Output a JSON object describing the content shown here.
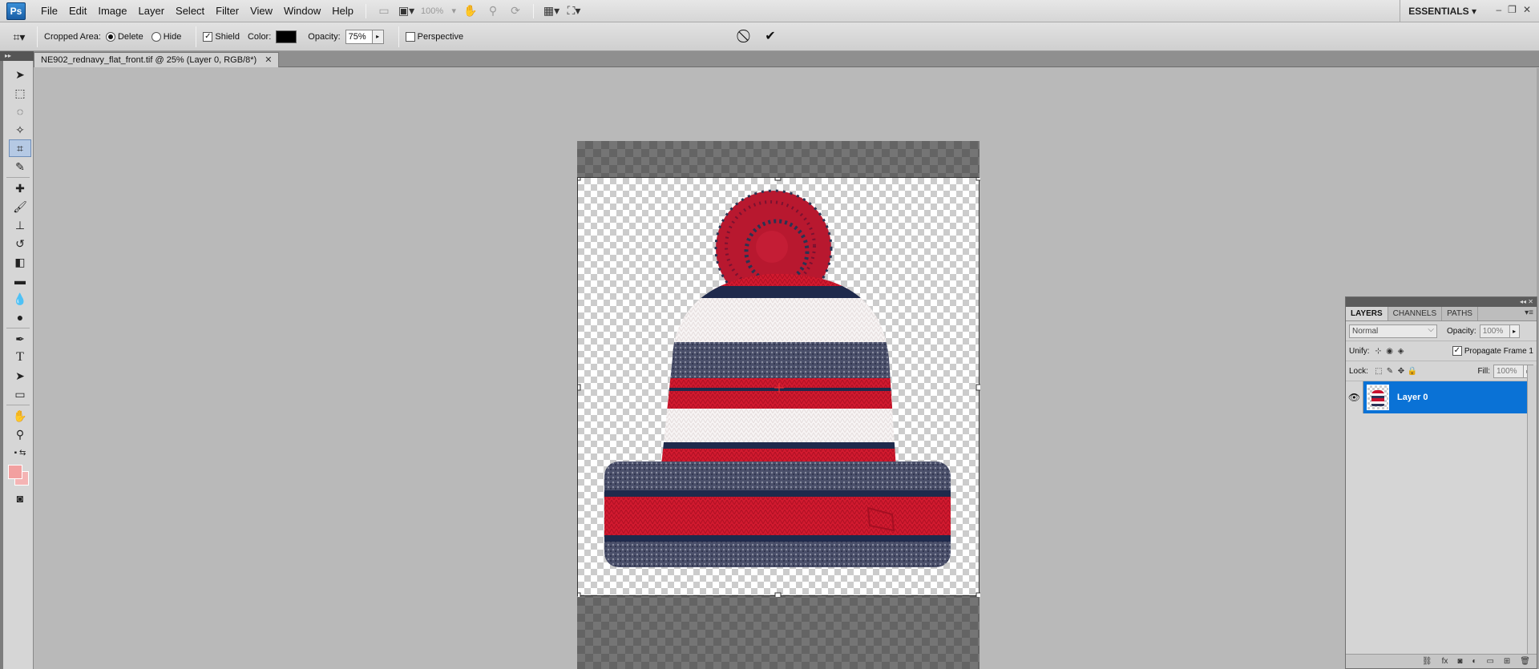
{
  "menubar": {
    "logo": "Ps",
    "items": [
      "File",
      "Edit",
      "Image",
      "Layer",
      "Select",
      "Filter",
      "View",
      "Window",
      "Help"
    ],
    "zoom": "100%",
    "workspace": "ESSENTIALS"
  },
  "options": {
    "cropped_area_label": "Cropped Area:",
    "delete_label": "Delete",
    "hide_label": "Hide",
    "shield_label": "Shield",
    "color_label": "Color:",
    "shield_color": "#000000",
    "opacity_label": "Opacity:",
    "opacity_value": "75%",
    "perspective_label": "Perspective"
  },
  "document": {
    "tab_title": "NE902_rednavy_flat_front.tif @ 25% (Layer 0, RGB/8*)"
  },
  "layers_panel": {
    "tabs": [
      "LAYERS",
      "CHANNELS",
      "PATHS"
    ],
    "blend_mode": "Normal",
    "opacity_label": "Opacity:",
    "opacity_value": "100%",
    "unify_label": "Unify:",
    "propagate_label": "Propagate Frame 1",
    "lock_label": "Lock:",
    "fill_label": "Fill:",
    "fill_value": "100%",
    "layers": [
      {
        "name": "Layer 0",
        "visible": true,
        "selected": true
      }
    ]
  },
  "colors": {
    "foreground": "#f2a0a0",
    "background": "#f4b4b4",
    "selection": "#0a72d6"
  }
}
